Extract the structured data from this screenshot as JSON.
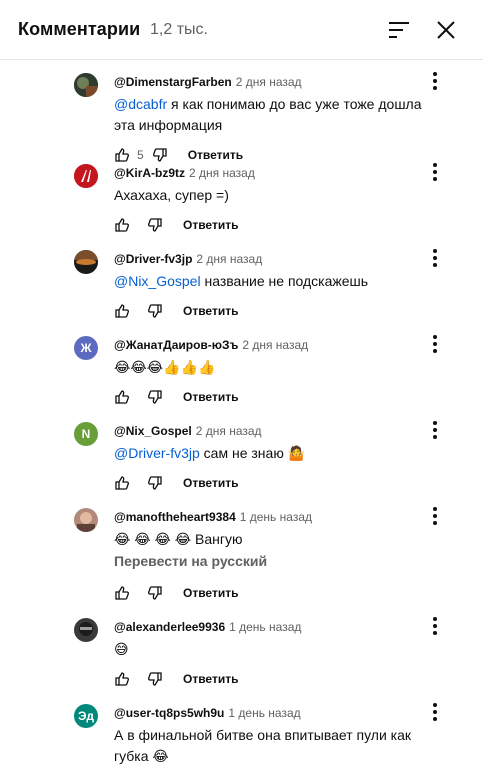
{
  "header": {
    "title": "Комментарии",
    "count": "1,2 тыс.",
    "sort_icon": "sort-icon",
    "close_icon": "close-icon"
  },
  "comments": [
    {
      "author": "@DimenstargFarben",
      "time": "2 дня назад",
      "mention": "@dcabfr",
      "text": " я как понимаю до вас уже тоже дошла эта информация",
      "likes": "5",
      "reply": "Ответить",
      "avatar_color": "#3a4a3a"
    },
    {
      "author": "@KirA-bz9tz",
      "time": "2 дня назад",
      "mention": "",
      "text": "Ахахаха, супер  =)",
      "likes": "",
      "reply": "Ответить",
      "avatar_color": "#c4161c"
    },
    {
      "author": "@Driver-fv3jp",
      "time": "2 дня назад",
      "mention": "@Nix_Gospel",
      "text": " название не подскажешь",
      "likes": "",
      "reply": "Ответить",
      "avatar_color": "#3b2a1e"
    },
    {
      "author": "@ЖанатДаиров-юЗъ",
      "time": "2 дня назад",
      "avatar_letter": "Ж",
      "mention": "",
      "text": "😂😂😂👍👍👍",
      "likes": "",
      "reply": "Ответить",
      "avatar_color": "#5c6bc0"
    },
    {
      "author": "@Nix_Gospel",
      "time": "2 дня назад",
      "avatar_letter": "N",
      "mention": "@Driver-fv3jp",
      "text": " сам не знаю 🤷",
      "likes": "",
      "reply": "Ответить",
      "avatar_color": "#689f38"
    },
    {
      "author": "@manoftheheart9384",
      "time": "1 день назад",
      "mention": "",
      "text": "😂 😂 😂 😂  Вангую",
      "translate": "Перевести на русский",
      "likes": "",
      "reply": "Ответить",
      "avatar_color": "#8d6e63"
    },
    {
      "author": "@alexanderlee9936",
      "time": "1 день назад",
      "mention": "",
      "text": "😅",
      "likes": "",
      "reply": "Ответить",
      "avatar_color": "#2e2e2e"
    },
    {
      "author": "@user-tq8ps5wh9u",
      "time": "1 день назад",
      "avatar_letter": "Эд",
      "mention": "",
      "text": "А в финальной битве она впитывает пули как губка 😂",
      "likes": "",
      "reply": "",
      "avatar_color": "#00897b"
    }
  ]
}
